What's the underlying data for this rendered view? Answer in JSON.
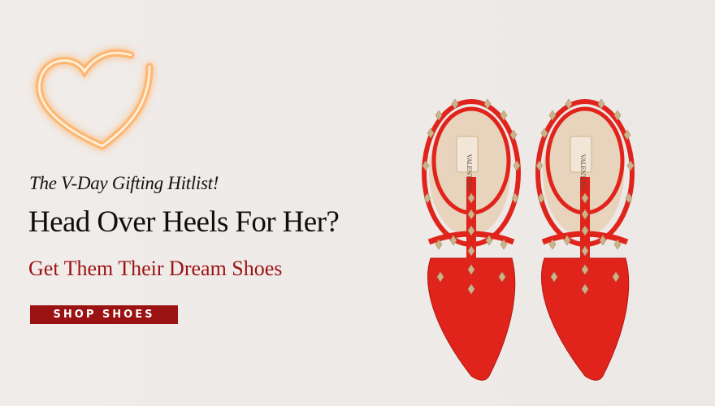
{
  "banner": {
    "kicker": "The V-Day Gifting Hitlist!",
    "headline": "Head Over Heels For Her?",
    "subheadline": "Get Them Their Dream Shoes",
    "cta_label": "SHOP SHOES",
    "shoe_brand_label": "VALENTINO"
  },
  "icons": {
    "heart": "neon-heart-icon",
    "product": "studded-pumps-image"
  },
  "colors": {
    "accent": "#9b1212",
    "neon_glow": "#ff9b1a",
    "shoe_red": "#e0241c",
    "stud_gold": "#cdb38a",
    "insole": "#e8d3bd"
  }
}
